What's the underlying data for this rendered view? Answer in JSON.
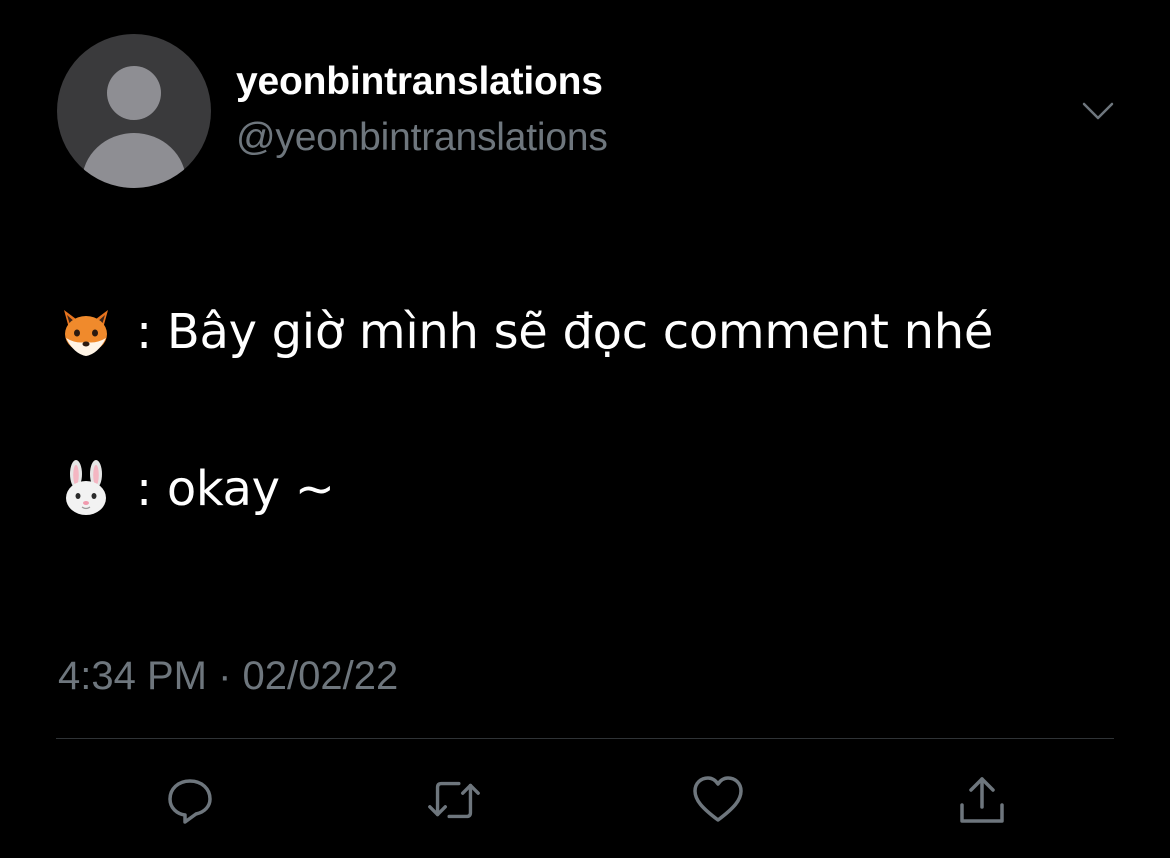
{
  "author": {
    "display_name": "yeonbintranslations",
    "handle": "@yeonbintranslations"
  },
  "tweet": {
    "lines": [
      {
        "icon": "fox-emoji",
        "text": ": Bây giờ mình sẽ đọc comment nhé"
      },
      {
        "icon": "rabbit-emoji",
        "text": ": okay ~"
      }
    ],
    "timestamp": "4:34 PM · 02/02/22"
  },
  "actions": {
    "icons": [
      "reply-icon",
      "retweet-icon",
      "like-icon",
      "share-icon"
    ]
  },
  "colors": {
    "background": "#000000",
    "text": "#ffffff",
    "secondary": "#6e767d",
    "divider": "#2f3336",
    "avatar_bg": "#3a3a3c",
    "avatar_fg": "#8e8e93"
  }
}
